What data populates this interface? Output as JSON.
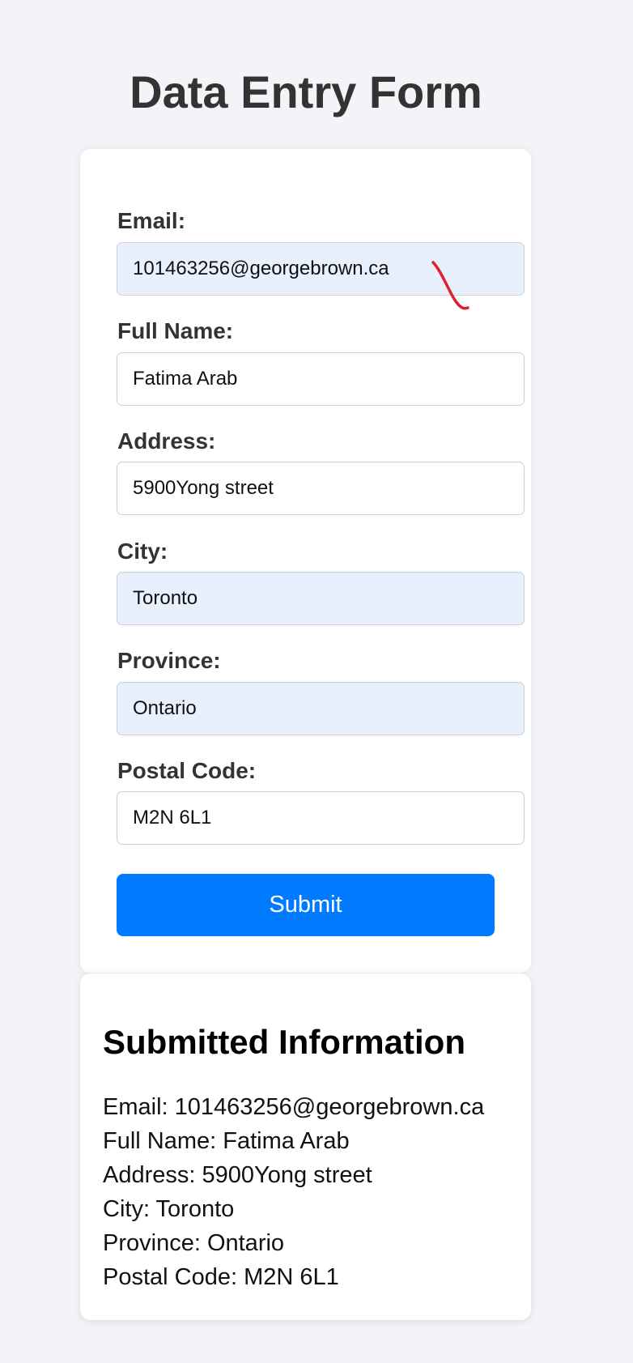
{
  "page": {
    "title": "Data Entry Form"
  },
  "form": {
    "fields": [
      {
        "label": "Email:",
        "value": "101463256@georgebrown.ca",
        "autofilled": true
      },
      {
        "label": "Full Name:",
        "value": "Fatima Arab",
        "autofilled": false
      },
      {
        "label": "Address:",
        "value": "5900Yong street",
        "autofilled": false
      },
      {
        "label": "City:",
        "value": "Toronto",
        "autofilled": true
      },
      {
        "label": "Province:",
        "value": "Ontario",
        "autofilled": true
      },
      {
        "label": "Postal Code:",
        "value": "M2N 6L1",
        "autofilled": false
      }
    ],
    "submit_label": "Submit"
  },
  "result": {
    "title": "Submitted Information",
    "lines": [
      "Email: 101463256@georgebrown.ca",
      "Full Name: Fatima Arab",
      "Address: 5900Yong street",
      "City: Toronto",
      "Province: Ontario",
      "Postal Code: M2N 6L1"
    ]
  },
  "colors": {
    "page_background": "#f4f4f8",
    "card_background": "#ffffff",
    "autofill_background": "#e8f0fe",
    "button_accent": "#007bff",
    "annotation_stroke": "#e0202a"
  }
}
